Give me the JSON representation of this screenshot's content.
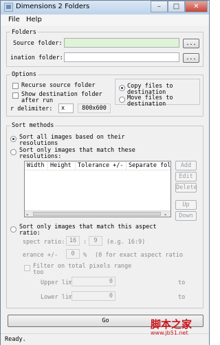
{
  "window": {
    "title": "Dimensions 2 Folders",
    "minimize": "–",
    "maximize": "□",
    "close": "✕"
  },
  "menu": [
    {
      "label": "File"
    },
    {
      "label": "Help"
    }
  ],
  "folders": {
    "group_title": "Folders",
    "source_label": "Source folder:",
    "source_value": "",
    "destination_label": "ination folder:",
    "destination_value": "",
    "browse_label": "..."
  },
  "options": {
    "group_title": "Options",
    "recurse_label": "Recurse source folder",
    "show_dest_line1": "Show destination folder",
    "show_dest_line2": "after run",
    "delimiter_label": "r delimiter:",
    "delimiter_value": "x",
    "example_value": "800x600",
    "copy_line1": "Copy files to",
    "copy_line2": "destination",
    "move_line1": "Move files to",
    "move_line2": "destination"
  },
  "sort": {
    "group_title": "Sort methods",
    "all_line1": "Sort all images based on their",
    "all_line2": "resolutions",
    "match_line1": "Sort only images that match these",
    "match_line2": "resolutions:",
    "columns": [
      "Width",
      "Height",
      "Tolerance +/-",
      "Separate fol"
    ],
    "buttons": {
      "add": "Add",
      "edit": "Edit",
      "delete": "Delete",
      "up": "Up",
      "down": "Down"
    },
    "aspect_line1": "Sort only images that match this aspect",
    "aspect_line2": "ratio:",
    "aspect_ratio_label": "spect ratio:",
    "aspect_w": "16",
    "aspect_sep": ":",
    "aspect_h": "9",
    "aspect_example": "(e.g. 16:9)",
    "tolerance_label": "erance +/-",
    "tolerance_value": "0",
    "tolerance_unit": "%",
    "tolerance_hint": "(0 for exact aspect ratio",
    "filter_line1": "Filter on total pixels range",
    "filter_line2": "too",
    "upper_label": "Upper lim",
    "upper_value": "0",
    "upper_to": "to",
    "lower_label": "Lower lim",
    "lower_value": "0",
    "lower_to": "to"
  },
  "go_label": "Go",
  "status": "Ready.",
  "watermark": {
    "logo": "脚本之家",
    "url": "www.jb51.net"
  }
}
